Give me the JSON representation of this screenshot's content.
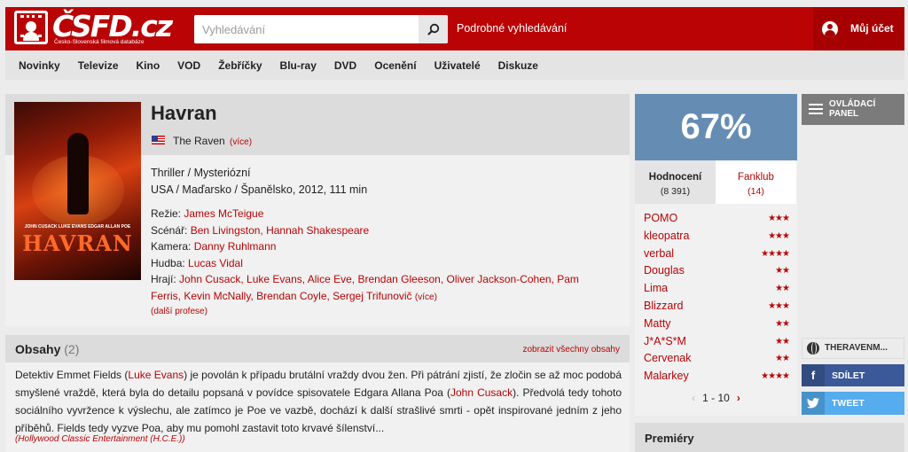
{
  "header": {
    "logo_text": "ČSFD.cz",
    "logo_subtitle": "Česko-Slovenská filmová databáze",
    "search_placeholder": "Vyhledávání",
    "advanced_search": "Podrobné vyhledávání",
    "account": "Můj účet",
    "brand_color": "#ba0305"
  },
  "nav": {
    "items": [
      {
        "label": "Novinky"
      },
      {
        "label": "Televize"
      },
      {
        "label": "Kino"
      },
      {
        "label": "VOD"
      },
      {
        "label": "Žebříčky"
      },
      {
        "label": "Blu-ray"
      },
      {
        "label": "DVD"
      },
      {
        "label": "Ocenění"
      },
      {
        "label": "Uživatelé"
      },
      {
        "label": "Diskuze"
      }
    ]
  },
  "film": {
    "title": "Havran",
    "alt_title": "The Raven",
    "alt_more": "(více)",
    "genre": "Thriller / Mysteriózní",
    "origin": "USA / Maďarsko / Španělsko, 2012, 111 min",
    "poster": {
      "cast_text": "JOHN CUSACK  LUKE EVANS  EDGAR ALLAN POE",
      "title_text": "HAVRAN"
    },
    "credits": [
      {
        "label": "Režie:",
        "names": "James McTeigue"
      },
      {
        "label": "Scénář:",
        "names": "Ben Livingston, Hannah Shakespeare"
      },
      {
        "label": "Kamera:",
        "names": "Danny Ruhlmann"
      },
      {
        "label": "Hudba:",
        "names": "Lucas Vidal"
      },
      {
        "label": "Hrají:",
        "names": "John Cusack, Luke Evans, Alice Eve, Brendan Gleeson, Oliver Jackson-Cohen, Pam Ferris, Kevin McNally, Brendan Coyle, Sergej Trifunovič",
        "more": "(více)"
      }
    ],
    "other_professions": "(další profese)"
  },
  "summary": {
    "title": "Obsahy",
    "count": "(2)",
    "show_all": "zobrazit všechny obsahy",
    "text_1": "Detektiv Emmet Fields (",
    "actor_1": "Luke Evans",
    "text_2": ") je povolán k případu brutální vraždy dvou žen. Při pátrání zjistí, že zločin se až moc podobá smyšlené vraždě, která byla do detailu popsaná v povídce spisovatele Edgara Allana Poa (",
    "actor_2": "John Cusack",
    "text_3": "). Předvolá tedy tohoto sociálního vyvržence k výslechu, ale zatímco je Poe ve vazbě, dochází k další strašlivé smrti - opět inspirované jedním z jeho příběhů. Fields tedy vyzve Poa, aby mu pomohl zastavit toto krvavé šílenství...",
    "source": "(Hollywood Classic Entertainment (H.C.E.))"
  },
  "rating": {
    "percent": "67%",
    "percent_value": 67,
    "box_color": "#658db4",
    "tab_ratings_label": "Hodnocení",
    "tab_ratings_count": "(8 391)",
    "tab_fanclub_label": "Fanklub",
    "tab_fanclub_count": "(14)",
    "users": [
      {
        "name": "POMO",
        "stars": "★★★"
      },
      {
        "name": "kleopatra",
        "stars": "★★★"
      },
      {
        "name": "verbal",
        "stars": "★★★★"
      },
      {
        "name": "Douglas",
        "stars": "★★"
      },
      {
        "name": "Lima",
        "stars": "★★"
      },
      {
        "name": "Blizzard",
        "stars": "★★★"
      },
      {
        "name": "Matty",
        "stars": "★★"
      },
      {
        "name": "J*A*S*M",
        "stars": "★★"
      },
      {
        "name": "Cervenak",
        "stars": "★★"
      },
      {
        "name": "Malarkey",
        "stars": "★★★★"
      }
    ],
    "pager": "1 - 10"
  },
  "sidebar": {
    "control_panel": "OVLÁDACÍ PANEL",
    "official_site": "THERAVENM...",
    "share": "SDÍLET",
    "tweet": "TWEET",
    "facebook_color": "#3b5998",
    "twitter_color": "#55acee"
  },
  "premieres": {
    "title": "Premiéry"
  }
}
